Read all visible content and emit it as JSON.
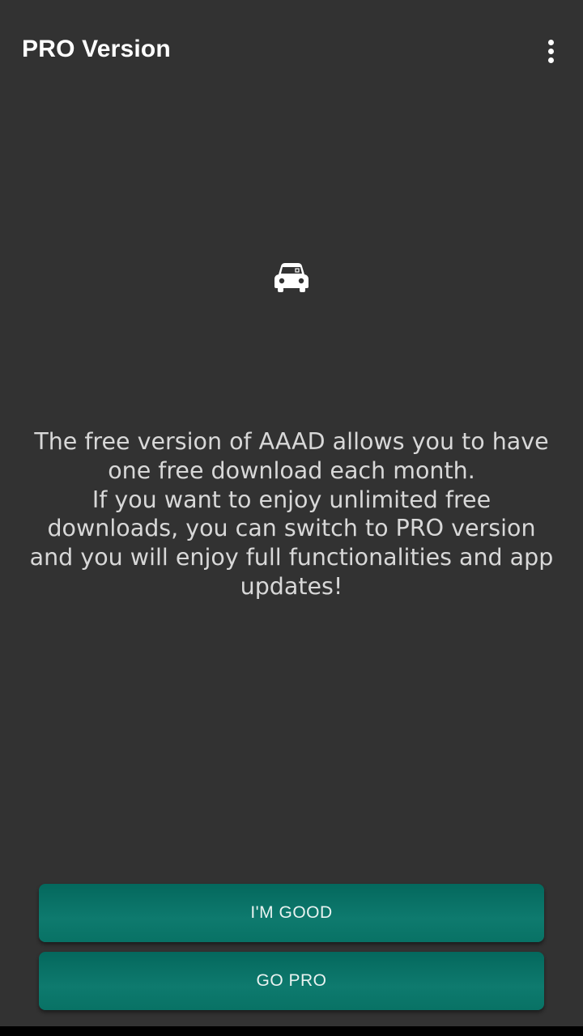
{
  "app_bar": {
    "title": "PRO Version",
    "menu_icon": "more-vert-icon"
  },
  "hero": {
    "icon": "car-icon"
  },
  "message": {
    "text": "The free version of AAAD allows you to have one free download each month.\nIf you want to enjoy unlimited free downloads, you can switch to PRO version and you will enjoy full functionalities and app updates!"
  },
  "buttons": {
    "im_good": "I'M GOOD",
    "go_pro": "GO PRO"
  },
  "colors": {
    "background": "#323232",
    "button": "#0a7165",
    "text": "#d8d8d8"
  }
}
